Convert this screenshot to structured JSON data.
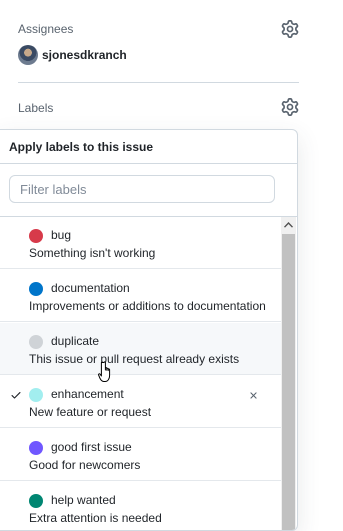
{
  "assignees": {
    "heading": "Assignees",
    "user": "sjonesdkranch"
  },
  "labels_section": {
    "heading": "Labels"
  },
  "label_picker": {
    "title": "Apply labels to this issue",
    "filter_placeholder": "Filter labels",
    "filter_value": "",
    "items": [
      {
        "name": "bug",
        "description": "Something isn't working",
        "color": "#d73a4a",
        "selected": false
      },
      {
        "name": "documentation",
        "description": "Improvements or additions to documentation",
        "color": "#0075ca",
        "selected": false
      },
      {
        "name": "duplicate",
        "description": "This issue or pull request already exists",
        "color": "#cfd3d7",
        "selected": false
      },
      {
        "name": "enhancement",
        "description": "New feature or request",
        "color": "#a2eeef",
        "selected": true
      },
      {
        "name": "good first issue",
        "description": "Good for newcomers",
        "color": "#7057ff",
        "selected": false
      },
      {
        "name": "help wanted",
        "description": "Extra attention is needed",
        "color": "#008672",
        "selected": false
      }
    ]
  },
  "icons": {
    "settings": "gear-icon",
    "selected": "check-icon",
    "remove": "x-icon",
    "scroll_up": "chevron-up-icon"
  }
}
